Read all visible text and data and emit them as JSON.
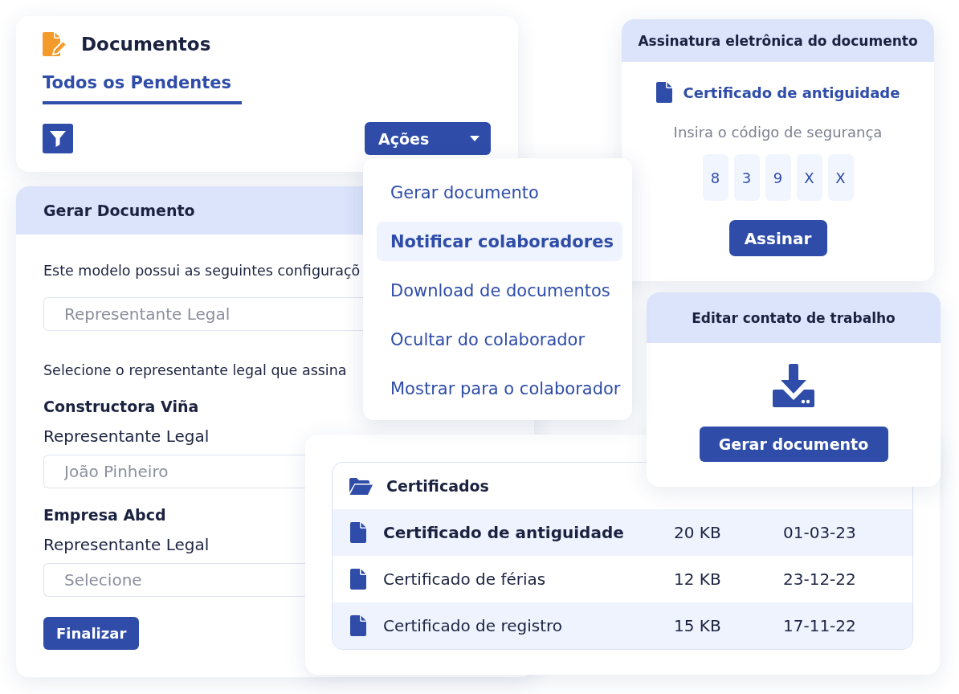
{
  "documents_card": {
    "title": "Documentos",
    "tabs": [
      {
        "label": "Todos os Pendentes",
        "selected": true
      }
    ],
    "actions_button": "Ações"
  },
  "actions_menu": {
    "items": [
      {
        "label": "Gerar documento",
        "selected": false
      },
      {
        "label": "Notificar colaboradores",
        "selected": true
      },
      {
        "label": "Download de documentos",
        "selected": false
      },
      {
        "label": "Ocultar do colaborador",
        "selected": false
      },
      {
        "label": "Mostrar para o colaborador",
        "selected": false
      }
    ]
  },
  "signature_card": {
    "title": "Assinatura eletrônica do documento",
    "document": "Certificado de antiguidade",
    "prompt": "Insira o código de segurança",
    "code": [
      "8",
      "3",
      "9",
      "X",
      "X"
    ],
    "sign_button": "Assinar"
  },
  "generate_panel": {
    "title": "Gerar Documento",
    "intro": "Este modelo possui as seguintes configuraçõ",
    "config_field": {
      "value": "Representante Legal"
    },
    "instruction": "Selecione o representante legal que assina",
    "companies": [
      {
        "name": "Constructora Viña",
        "label": "Representante Legal",
        "field": {
          "value": "João Pinheiro"
        }
      },
      {
        "name": "Empresa Abcd",
        "label": "Representante Legal",
        "field": {
          "placeholder": "Selecione"
        }
      }
    ],
    "submit_button": "Finalizar"
  },
  "contact_card": {
    "title": "Editar contato de trabalho",
    "button": "Gerar documento"
  },
  "files_table": {
    "folder": "Certificados",
    "rows": [
      {
        "name": "Certificado de antiguidade",
        "size": "20 KB",
        "date": "01-03-23",
        "selected": true
      },
      {
        "name": "Certificado de férias",
        "size": "12 KB",
        "date": "23-12-22",
        "selected": false
      },
      {
        "name": "Certificado de registro",
        "size": "15 KB",
        "date": "17-11-22",
        "selected": false
      }
    ]
  }
}
